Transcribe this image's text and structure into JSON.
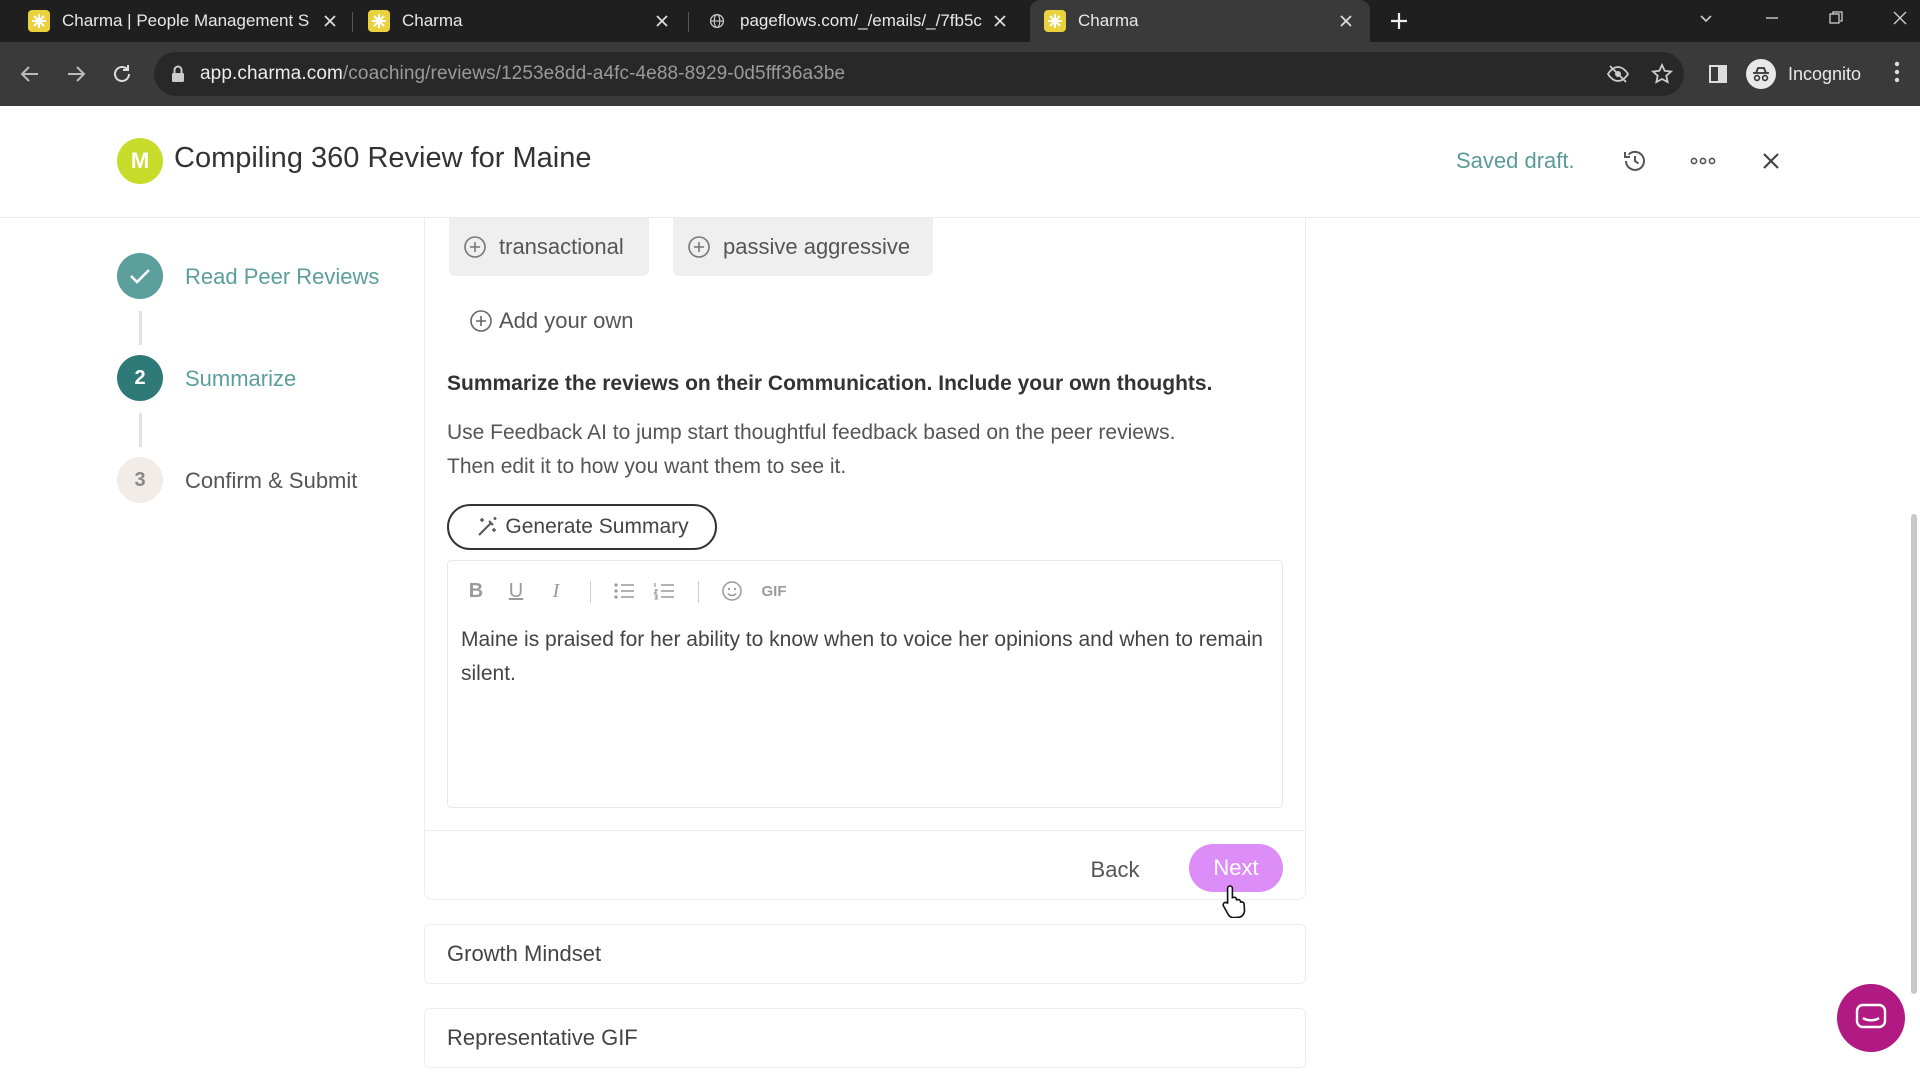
{
  "browser": {
    "tabs": [
      {
        "title": "Charma | People Management S",
        "active": false,
        "favicon": "charma-icon"
      },
      {
        "title": "Charma",
        "active": false,
        "favicon": "charma-icon"
      },
      {
        "title": "pageflows.com/_/emails/_/7fb5c",
        "active": false,
        "favicon": "globe-icon"
      },
      {
        "title": "Charma",
        "active": true,
        "favicon": "charma-icon"
      }
    ],
    "url_host": "app.charma.com",
    "url_path": "/coaching/reviews/1253e8dd-a4fc-4e88-8929-0d5fff36a3be",
    "profile_label": "Incognito"
  },
  "header": {
    "avatar_initial": "M",
    "title": "Compiling 360 Review for Maine",
    "saved_status": "Saved draft."
  },
  "steps": [
    {
      "number": "✓",
      "label": "Read Peer Reviews",
      "state": "done"
    },
    {
      "number": "2",
      "label": "Summarize",
      "state": "current"
    },
    {
      "number": "3",
      "label": "Confirm & Submit",
      "state": "todo"
    }
  ],
  "tags": [
    "transactional",
    "passive aggressive"
  ],
  "add_own_label": "Add your own",
  "summary": {
    "prompt": "Summarize the reviews on their Communication. Include your own thoughts.",
    "description_line1": "Use Feedback AI to jump start thoughtful feedback based on the peer reviews.",
    "description_line2": "Then edit it to how you want them to see it.",
    "generate_button": "Generate Summary",
    "editor_gif_label": "GIF",
    "editor_text": "Maine is praised for her ability to know when to voice her opinions and when to remain silent."
  },
  "actions": {
    "back": "Back",
    "next": "Next"
  },
  "sections": [
    "Growth Mindset",
    "Representative GIF"
  ],
  "colors": {
    "teal": "#5b9e9c",
    "next_button": "#dd8df7",
    "avatar": "#c7dc2a",
    "chat_bubble": "#b01a82"
  }
}
